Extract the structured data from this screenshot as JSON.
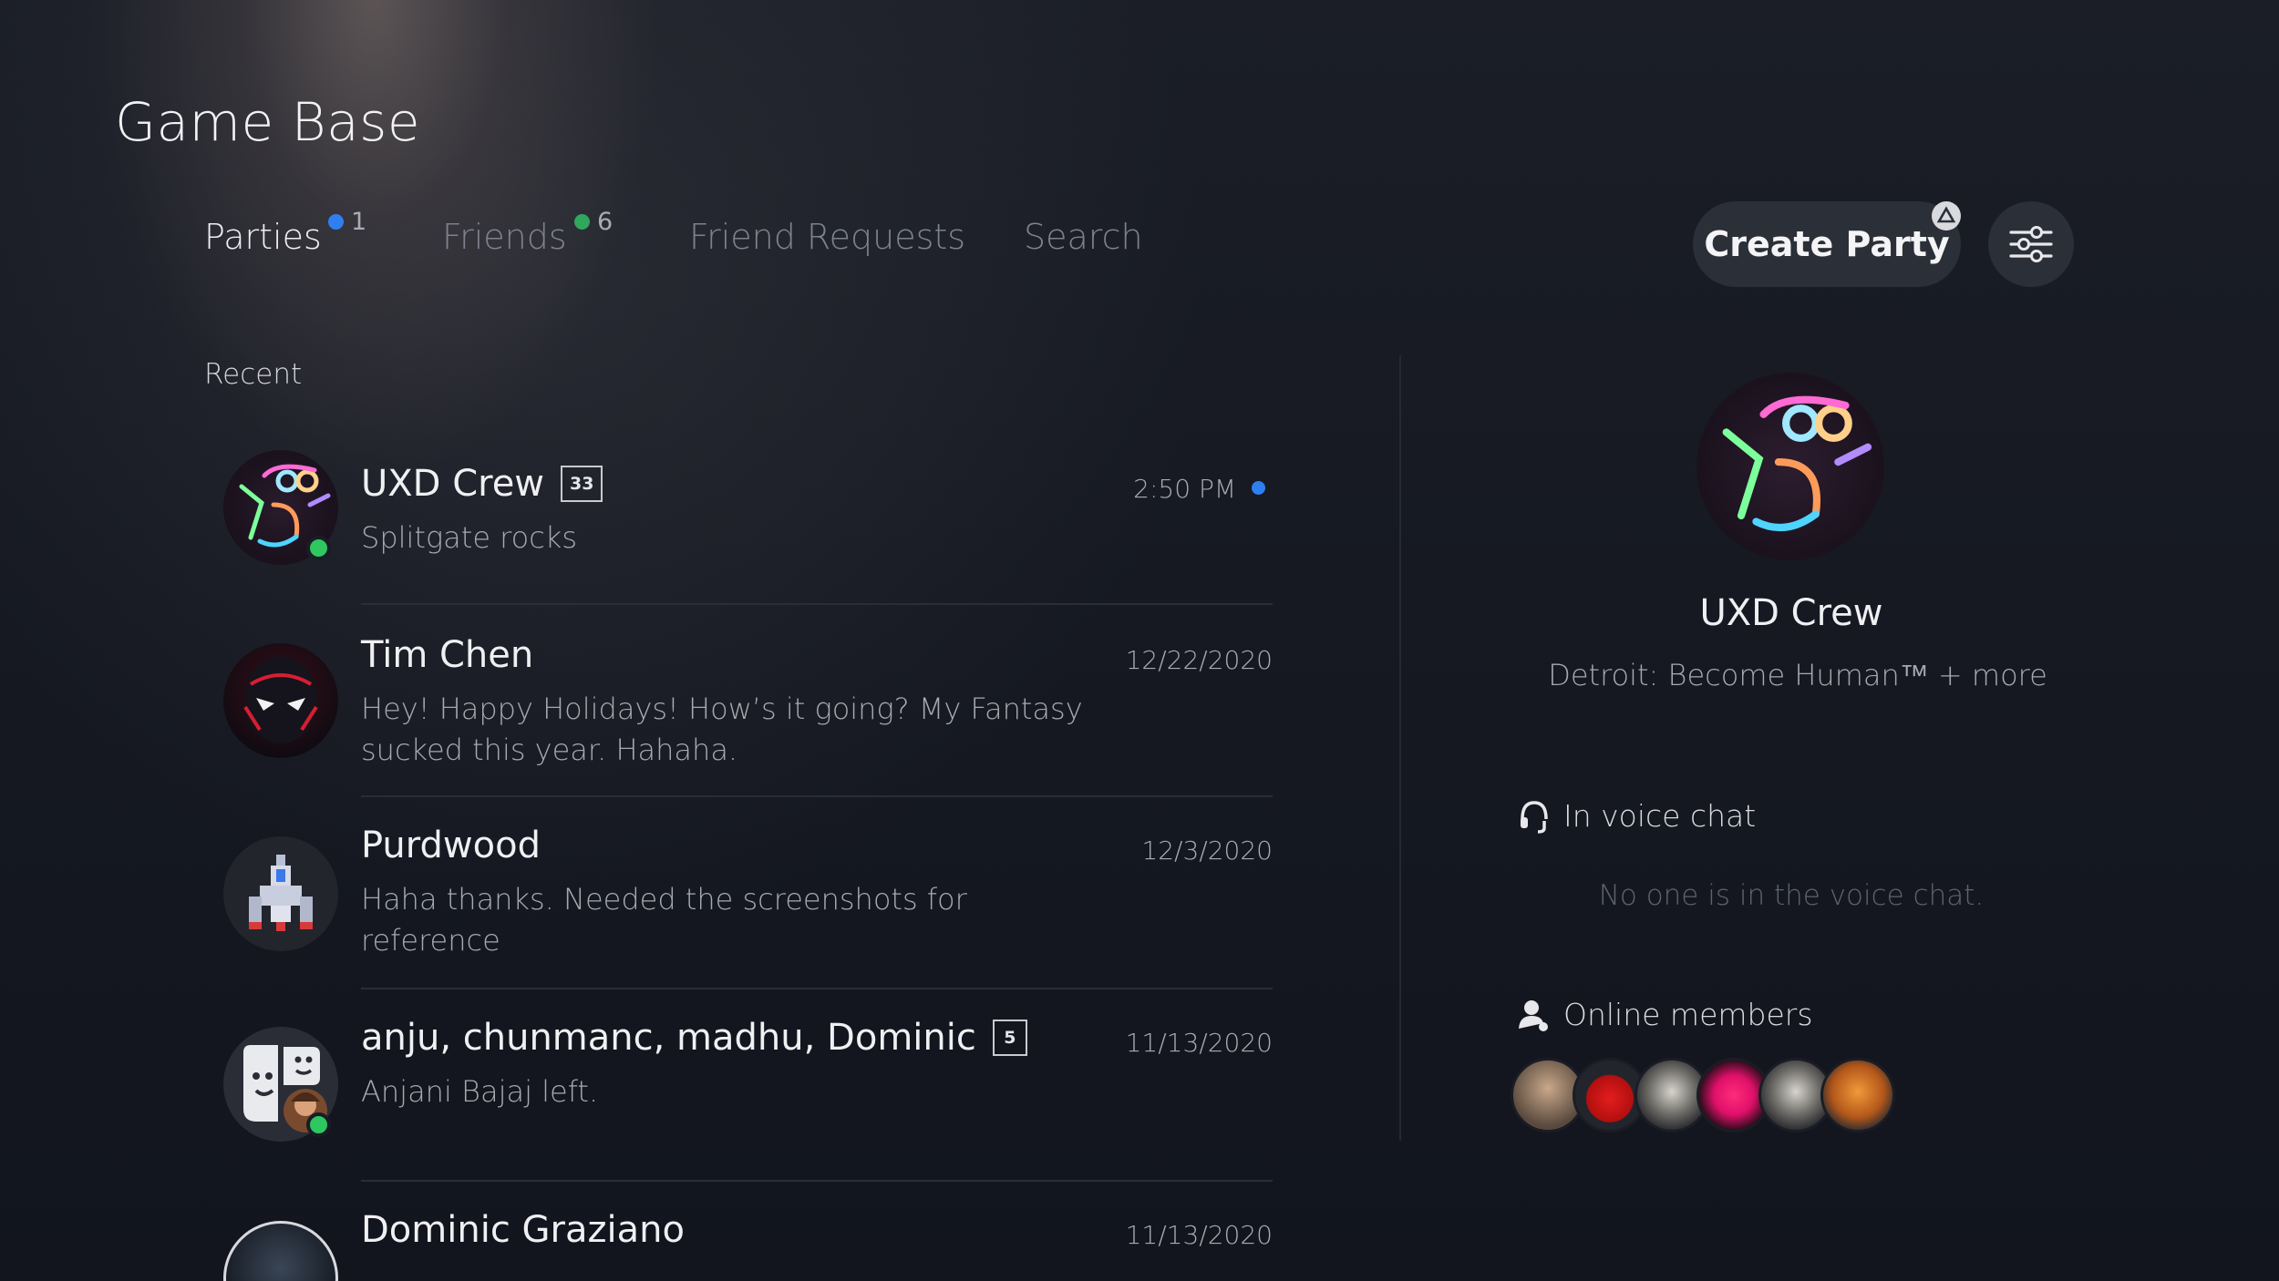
{
  "header": {
    "title": "Game Base"
  },
  "tabs": [
    {
      "label": "Parties",
      "badge": "1",
      "badge_color": "#2f7ff2",
      "active": true
    },
    {
      "label": "Friends",
      "badge": "6",
      "badge_color": "#2fa75d",
      "active": false
    },
    {
      "label": "Friend Requests",
      "active": false
    },
    {
      "label": "Search",
      "active": false
    }
  ],
  "actions": {
    "create_party_label": "Create Party",
    "create_party_icon": "triangle-icon",
    "filter_icon": "sliders-icon"
  },
  "list": {
    "section_label": "Recent",
    "items": [
      {
        "name": "UXD Crew",
        "count": "33",
        "message": "Splitgate rocks",
        "time": "2:50 PM",
        "unread": true,
        "online": true
      },
      {
        "name": "Tim Chen",
        "message": "Hey! Happy Holidays! How’s it going? My Fantasy sucked this year. Hahaha.",
        "time": "12/22/2020"
      },
      {
        "name": "Purdwood",
        "message": "Haha thanks. Needed the screenshots for reference",
        "time": "12/3/2020"
      },
      {
        "name": "anju, chunmanc, madhu, Dominic",
        "count": "5",
        "message": "Anjani Bajaj left.",
        "time": "11/13/2020",
        "online": true
      },
      {
        "name": "Dominic Graziano",
        "message": "",
        "time": "11/13/2020"
      }
    ]
  },
  "detail": {
    "name": "UXD Crew",
    "game": "Detroit: Become Human™ + more",
    "voice_chat_heading": "In voice chat",
    "voice_chat_empty": "No one is in the voice chat.",
    "online_members_heading": "Online members",
    "member_count": 6
  },
  "colors": {
    "accent_blue": "#2f7ff2",
    "online_green": "#2ec760",
    "background": "#161922"
  }
}
